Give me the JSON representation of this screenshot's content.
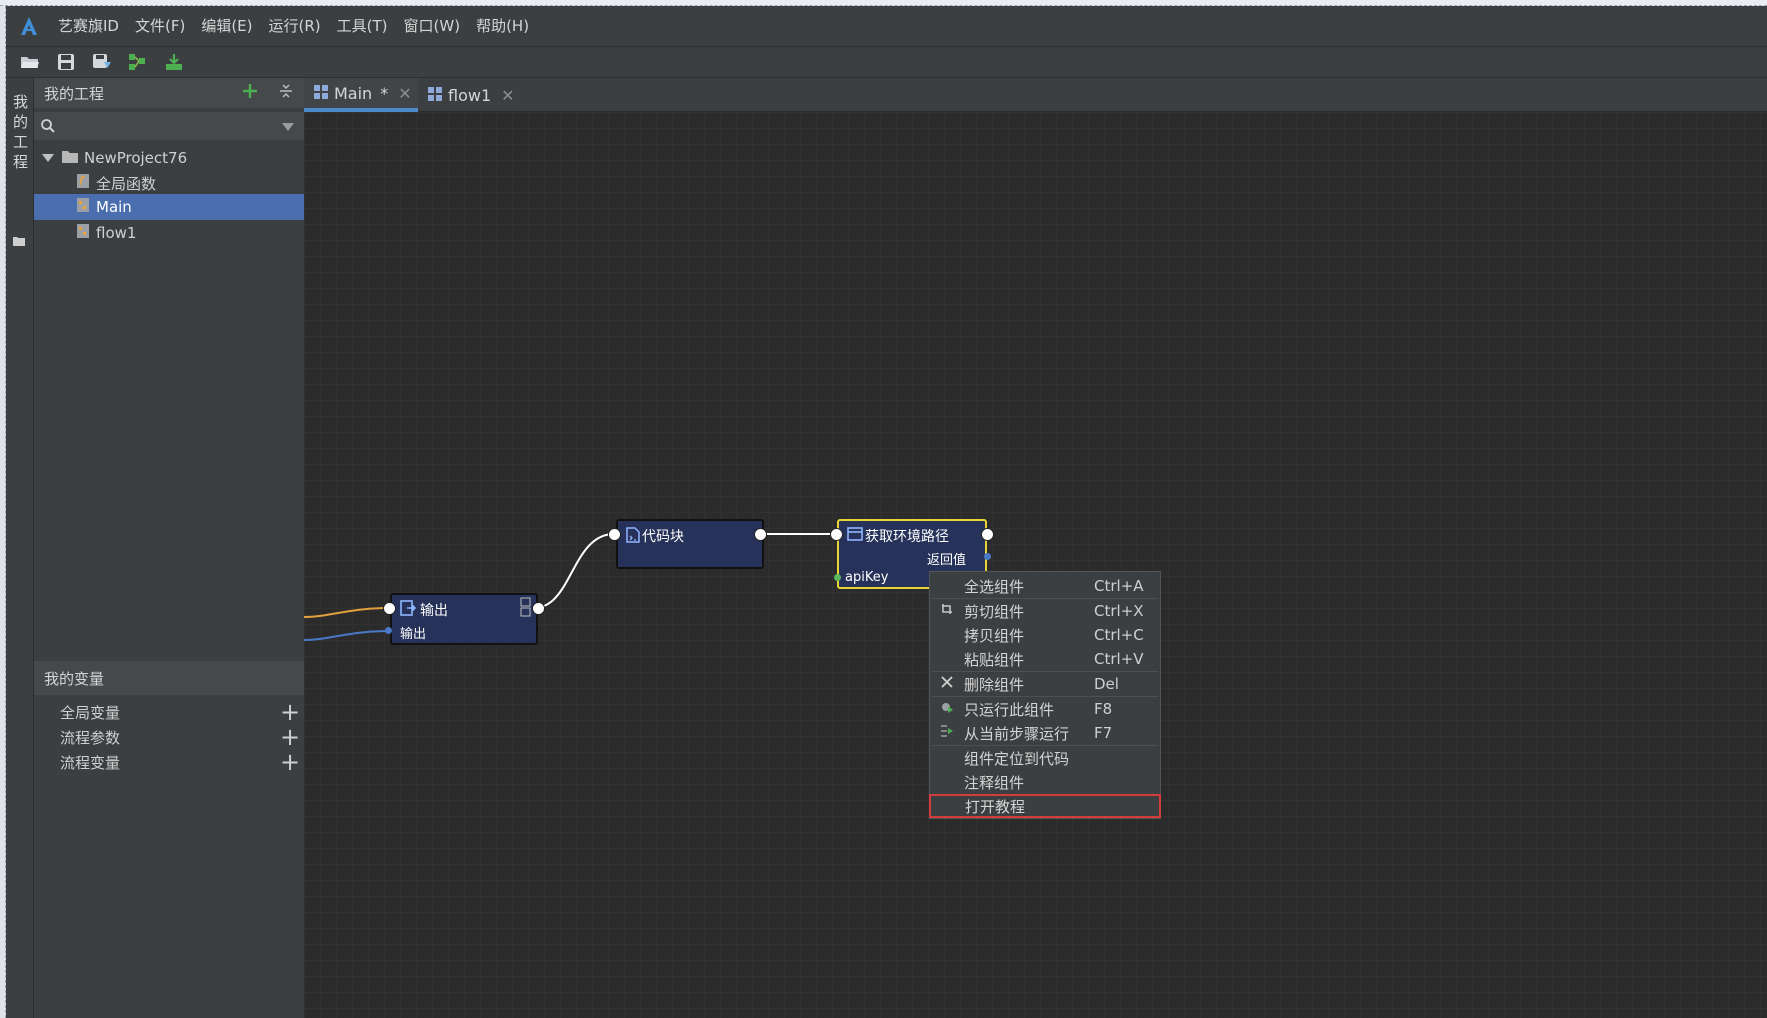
{
  "app": {
    "logo_icon": "aisaiqi-logo-icon",
    "menus": [
      "艺赛旗ID",
      "文件(F)",
      "编辑(E)",
      "运行(R)",
      "工具(T)",
      "窗口(W)",
      "帮助(H)"
    ]
  },
  "toolbar": {
    "buttons": [
      "open-folder-icon",
      "save-icon",
      "save-all-icon",
      "flow-run-icon",
      "download-icon"
    ]
  },
  "left_strip": {
    "label": "我的工程"
  },
  "project_panel": {
    "title": "我的工程",
    "search_placeholder": "",
    "tree": {
      "root": "NewProject76",
      "children": [
        "全局函数",
        "Main",
        "flow1"
      ],
      "selected": "Main"
    }
  },
  "variables_panel": {
    "title": "我的变量",
    "items": [
      "全局变量",
      "流程参数",
      "流程变量"
    ]
  },
  "tabs": [
    {
      "label": "Main",
      "modified": "*",
      "active": true
    },
    {
      "label": "flow1",
      "modified": "",
      "active": false
    }
  ],
  "canvas": {
    "nodes": [
      {
        "title": "输出",
        "port_label": "输出"
      },
      {
        "title": "代码块"
      },
      {
        "title": "获取环境路径",
        "output_label": "返回值",
        "input_label": "apiKey"
      }
    ],
    "colors": {
      "node_bg": "#263259",
      "selected_border": "#e8d533",
      "wire_orange": "#e0a040",
      "wire_blue": "#4a78c8",
      "wire_white": "#ffffff"
    }
  },
  "context_menu": {
    "items": [
      {
        "label": "全选组件",
        "shortcut": "Ctrl+A",
        "icon": ""
      },
      {
        "label": "剪切组件",
        "shortcut": "Ctrl+X",
        "icon": "cut-icon"
      },
      {
        "label": "拷贝组件",
        "shortcut": "Ctrl+C",
        "icon": ""
      },
      {
        "label": "粘贴组件",
        "shortcut": "Ctrl+V",
        "icon": ""
      },
      {
        "label": "删除组件",
        "shortcut": "Del",
        "icon": "delete-icon"
      },
      {
        "label": "只运行此组件",
        "shortcut": "F8",
        "icon": "run-single-icon"
      },
      {
        "label": "从当前步骤运行",
        "shortcut": "F7",
        "icon": "run-from-step-icon"
      },
      {
        "label": "组件定位到代码",
        "shortcut": "",
        "icon": ""
      },
      {
        "label": "注释组件",
        "shortcut": "",
        "icon": ""
      },
      {
        "label": "打开教程",
        "shortcut": "",
        "icon": ""
      }
    ],
    "highlighted": "打开教程"
  }
}
